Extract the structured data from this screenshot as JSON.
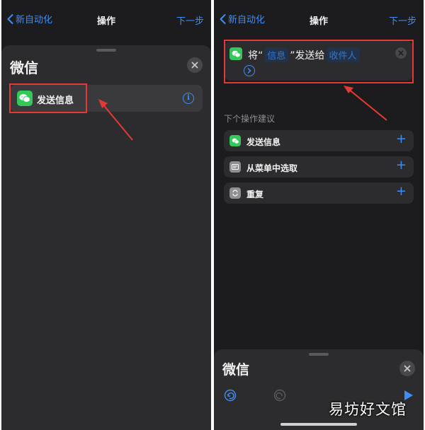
{
  "left": {
    "nav": {
      "back_label": "新自动化",
      "title": "操作",
      "next_label": "下一步"
    },
    "sheet_title": "微信",
    "action_label": "发送信息",
    "info_glyph": "i"
  },
  "right": {
    "nav": {
      "back_label": "新自动化",
      "title": "操作",
      "next_label": "下一步"
    },
    "message": {
      "prefix": "将“",
      "token_message": "信息",
      "middle": "”发送给",
      "token_recipient": "收件人"
    },
    "suggest_header": "下个操作建议",
    "suggestions": [
      {
        "label": "发送信息",
        "icon": "wechat-icon",
        "color": "#34c759"
      },
      {
        "label": "从菜单中选取",
        "icon": "menu-icon",
        "color": "#8e8e93"
      },
      {
        "label": "重复",
        "icon": "repeat-icon",
        "color": "#8e8e93"
      }
    ],
    "bottom_sheet_title": "微信"
  },
  "watermark": "易坊好文馆",
  "colors": {
    "accent": "#3e8ef7",
    "highlight": "#e53935",
    "wechat_green": "#34c759",
    "background": "#1c1c1e"
  }
}
